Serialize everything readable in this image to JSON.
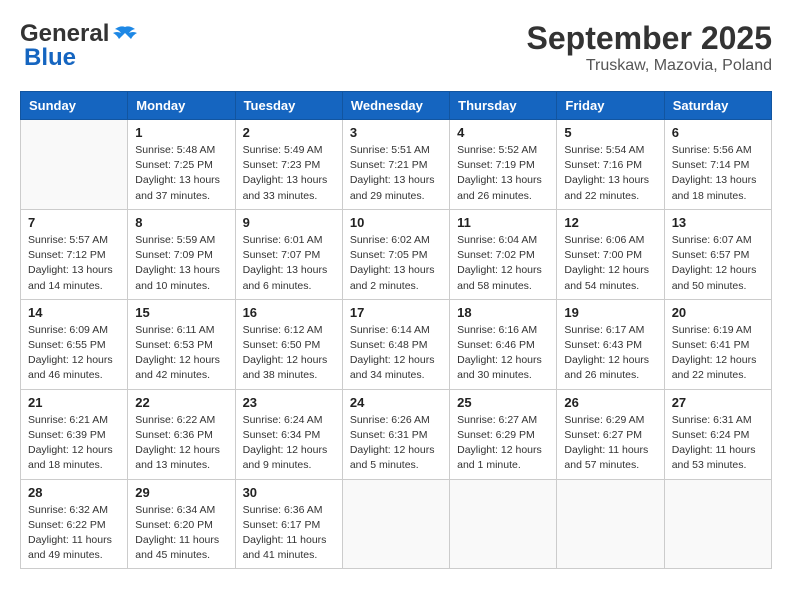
{
  "header": {
    "logo_line1": "General",
    "logo_line2": "Blue",
    "month": "September 2025",
    "location": "Truskaw, Mazovia, Poland"
  },
  "weekdays": [
    "Sunday",
    "Monday",
    "Tuesday",
    "Wednesday",
    "Thursday",
    "Friday",
    "Saturday"
  ],
  "weeks": [
    [
      {
        "day": "",
        "info": ""
      },
      {
        "day": "1",
        "info": "Sunrise: 5:48 AM\nSunset: 7:25 PM\nDaylight: 13 hours\nand 37 minutes."
      },
      {
        "day": "2",
        "info": "Sunrise: 5:49 AM\nSunset: 7:23 PM\nDaylight: 13 hours\nand 33 minutes."
      },
      {
        "day": "3",
        "info": "Sunrise: 5:51 AM\nSunset: 7:21 PM\nDaylight: 13 hours\nand 29 minutes."
      },
      {
        "day": "4",
        "info": "Sunrise: 5:52 AM\nSunset: 7:19 PM\nDaylight: 13 hours\nand 26 minutes."
      },
      {
        "day": "5",
        "info": "Sunrise: 5:54 AM\nSunset: 7:16 PM\nDaylight: 13 hours\nand 22 minutes."
      },
      {
        "day": "6",
        "info": "Sunrise: 5:56 AM\nSunset: 7:14 PM\nDaylight: 13 hours\nand 18 minutes."
      }
    ],
    [
      {
        "day": "7",
        "info": "Sunrise: 5:57 AM\nSunset: 7:12 PM\nDaylight: 13 hours\nand 14 minutes."
      },
      {
        "day": "8",
        "info": "Sunrise: 5:59 AM\nSunset: 7:09 PM\nDaylight: 13 hours\nand 10 minutes."
      },
      {
        "day": "9",
        "info": "Sunrise: 6:01 AM\nSunset: 7:07 PM\nDaylight: 13 hours\nand 6 minutes."
      },
      {
        "day": "10",
        "info": "Sunrise: 6:02 AM\nSunset: 7:05 PM\nDaylight: 13 hours\nand 2 minutes."
      },
      {
        "day": "11",
        "info": "Sunrise: 6:04 AM\nSunset: 7:02 PM\nDaylight: 12 hours\nand 58 minutes."
      },
      {
        "day": "12",
        "info": "Sunrise: 6:06 AM\nSunset: 7:00 PM\nDaylight: 12 hours\nand 54 minutes."
      },
      {
        "day": "13",
        "info": "Sunrise: 6:07 AM\nSunset: 6:57 PM\nDaylight: 12 hours\nand 50 minutes."
      }
    ],
    [
      {
        "day": "14",
        "info": "Sunrise: 6:09 AM\nSunset: 6:55 PM\nDaylight: 12 hours\nand 46 minutes."
      },
      {
        "day": "15",
        "info": "Sunrise: 6:11 AM\nSunset: 6:53 PM\nDaylight: 12 hours\nand 42 minutes."
      },
      {
        "day": "16",
        "info": "Sunrise: 6:12 AM\nSunset: 6:50 PM\nDaylight: 12 hours\nand 38 minutes."
      },
      {
        "day": "17",
        "info": "Sunrise: 6:14 AM\nSunset: 6:48 PM\nDaylight: 12 hours\nand 34 minutes."
      },
      {
        "day": "18",
        "info": "Sunrise: 6:16 AM\nSunset: 6:46 PM\nDaylight: 12 hours\nand 30 minutes."
      },
      {
        "day": "19",
        "info": "Sunrise: 6:17 AM\nSunset: 6:43 PM\nDaylight: 12 hours\nand 26 minutes."
      },
      {
        "day": "20",
        "info": "Sunrise: 6:19 AM\nSunset: 6:41 PM\nDaylight: 12 hours\nand 22 minutes."
      }
    ],
    [
      {
        "day": "21",
        "info": "Sunrise: 6:21 AM\nSunset: 6:39 PM\nDaylight: 12 hours\nand 18 minutes."
      },
      {
        "day": "22",
        "info": "Sunrise: 6:22 AM\nSunset: 6:36 PM\nDaylight: 12 hours\nand 13 minutes."
      },
      {
        "day": "23",
        "info": "Sunrise: 6:24 AM\nSunset: 6:34 PM\nDaylight: 12 hours\nand 9 minutes."
      },
      {
        "day": "24",
        "info": "Sunrise: 6:26 AM\nSunset: 6:31 PM\nDaylight: 12 hours\nand 5 minutes."
      },
      {
        "day": "25",
        "info": "Sunrise: 6:27 AM\nSunset: 6:29 PM\nDaylight: 12 hours\nand 1 minute."
      },
      {
        "day": "26",
        "info": "Sunrise: 6:29 AM\nSunset: 6:27 PM\nDaylight: 11 hours\nand 57 minutes."
      },
      {
        "day": "27",
        "info": "Sunrise: 6:31 AM\nSunset: 6:24 PM\nDaylight: 11 hours\nand 53 minutes."
      }
    ],
    [
      {
        "day": "28",
        "info": "Sunrise: 6:32 AM\nSunset: 6:22 PM\nDaylight: 11 hours\nand 49 minutes."
      },
      {
        "day": "29",
        "info": "Sunrise: 6:34 AM\nSunset: 6:20 PM\nDaylight: 11 hours\nand 45 minutes."
      },
      {
        "day": "30",
        "info": "Sunrise: 6:36 AM\nSunset: 6:17 PM\nDaylight: 11 hours\nand 41 minutes."
      },
      {
        "day": "",
        "info": ""
      },
      {
        "day": "",
        "info": ""
      },
      {
        "day": "",
        "info": ""
      },
      {
        "day": "",
        "info": ""
      }
    ]
  ]
}
